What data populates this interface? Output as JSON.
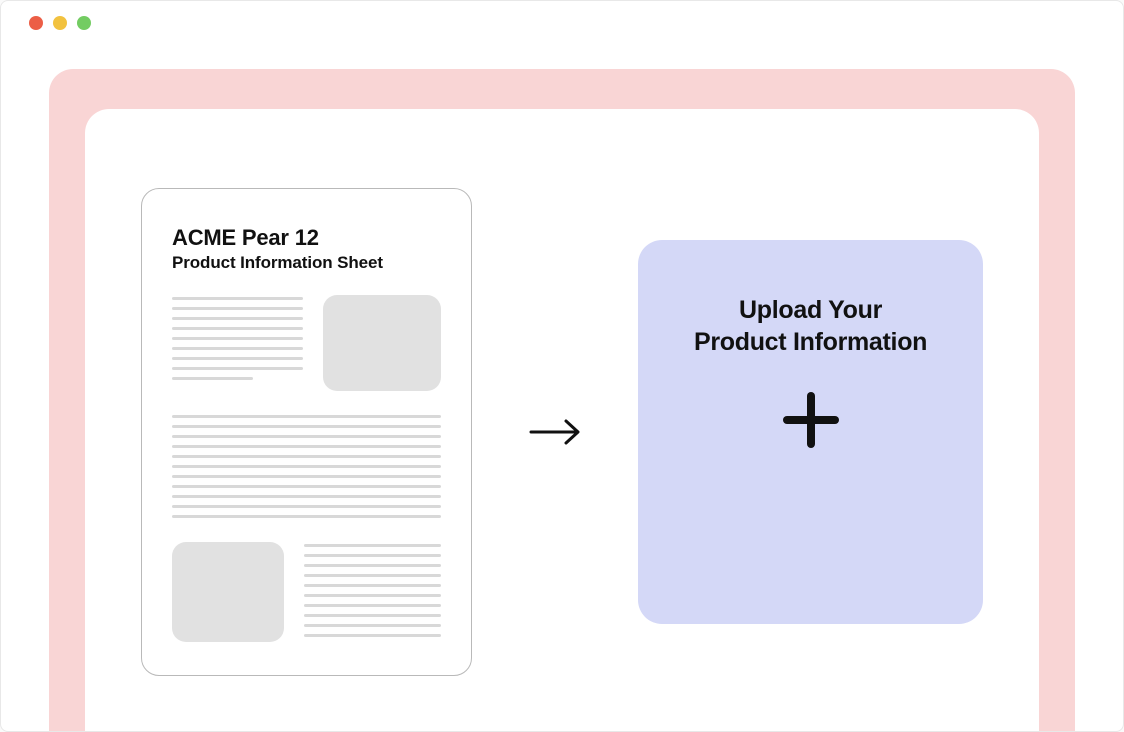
{
  "window": {
    "traffic_lights": [
      "red",
      "yellow",
      "green"
    ]
  },
  "document": {
    "title": "ACME  Pear 12",
    "subtitle": "Product Information Sheet"
  },
  "upload": {
    "title_line1": "Upload Your",
    "title_line2": "Product Information"
  },
  "icons": {
    "arrow": "arrow-right",
    "plus": "plus"
  }
}
